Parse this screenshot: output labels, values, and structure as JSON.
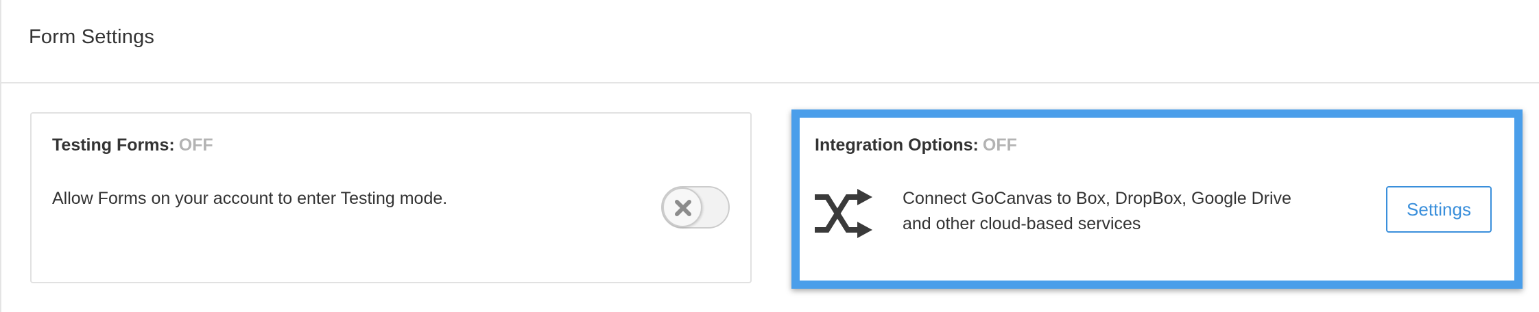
{
  "header": {
    "title": "Form Settings"
  },
  "testing_card": {
    "title": "Testing Forms:",
    "status": "OFF",
    "description": "Allow Forms on your account to enter Testing mode.",
    "toggle_on": false
  },
  "integration_card": {
    "title": "Integration Options:",
    "status": "OFF",
    "description_line1": "Connect GoCanvas to Box, DropBox, Google Drive",
    "description_line2": "and other cloud-based services",
    "icon": "shuffle-icon",
    "settings_label": "Settings"
  },
  "colors": {
    "accent": "#3a8fdb",
    "highlight_border": "#4a9eea",
    "status_off": "#b3b3b3"
  }
}
